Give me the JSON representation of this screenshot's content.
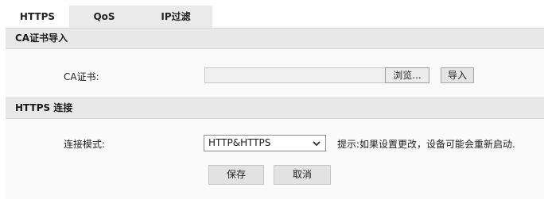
{
  "tabs": [
    {
      "label": "HTTPS",
      "active": true
    },
    {
      "label": "QoS",
      "active": false
    },
    {
      "label": "IP过滤",
      "active": false
    }
  ],
  "ca_section": {
    "title": "CA证书导入",
    "cert_label": "CA证书:",
    "file_value": "",
    "browse_label": "浏览...",
    "import_label": "导入"
  },
  "https_section": {
    "title": "HTTPS 连接",
    "mode_label": "连接模式:",
    "mode_selected": "HTTP&HTTPS",
    "hint": "提示:如果设置更改，设备可能会重新启动."
  },
  "actions": {
    "save_label": "保存",
    "cancel_label": "取消"
  },
  "icons": {
    "dropdown": "chevron-down-icon"
  }
}
